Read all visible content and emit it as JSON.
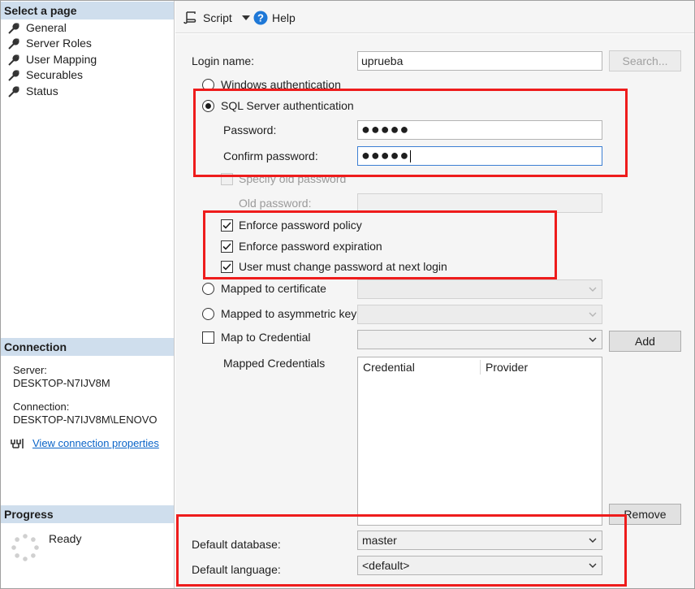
{
  "left_panel": {
    "select_page_header": "Select a page",
    "pages": [
      "General",
      "Server Roles",
      "User Mapping",
      "Securables",
      "Status"
    ],
    "connection_header": "Connection",
    "server_label": "Server:",
    "server_value": "DESKTOP-N7IJV8M",
    "connection_label": "Connection:",
    "connection_value": "DESKTOP-N7IJV8M\\LENOVO",
    "view_connection_link": "View connection properties",
    "progress_header": "Progress",
    "progress_status": "Ready"
  },
  "toolbar": {
    "script_label": "Script",
    "help_label": "Help"
  },
  "form": {
    "login_name_label": "Login name:",
    "login_name_value": "uprueba",
    "search_button": "Search...",
    "windows_auth_label": "Windows authentication",
    "sql_auth_label": "SQL Server authentication",
    "password_label": "Password:",
    "password_value": "●●●●●",
    "confirm_password_label": "Confirm password:",
    "confirm_password_value": "●●●●●",
    "specify_old_password_label": "Specify old password",
    "old_password_label": "Old password:",
    "enforce_policy_label": "Enforce password policy",
    "enforce_expiration_label": "Enforce password expiration",
    "must_change_label": "User must change password at next login",
    "mapped_certificate_label": "Mapped to certificate",
    "mapped_asym_key_label": "Mapped to asymmetric key",
    "map_credential_label": "Map to Credential",
    "add_button": "Add",
    "mapped_credentials_label": "Mapped Credentials",
    "credential_column": "Credential",
    "provider_column": "Provider",
    "remove_button": "Remove",
    "default_database_label": "Default database:",
    "default_database_value": "master",
    "default_language_label": "Default language:",
    "default_language_value": "<default>"
  },
  "state": {
    "windows_auth_selected": false,
    "sql_auth_selected": true,
    "specify_old_password_checked": false,
    "enforce_policy_checked": true,
    "enforce_expiration_checked": true,
    "must_change_checked": true,
    "mapped_certificate_selected": false,
    "mapped_asym_key_selected": false,
    "map_credential_checked": false
  },
  "colors": {
    "highlight_box": "#ee1c1c",
    "section_header_bg": "#cfdeed",
    "link": "#0a64c8",
    "help_icon": "#1e78d7"
  },
  "icons": {
    "page_item": "wrench-icon",
    "script": "script-icon",
    "help": "help-icon",
    "connection": "connection-icon",
    "progress": "progress-spinner-icon"
  }
}
